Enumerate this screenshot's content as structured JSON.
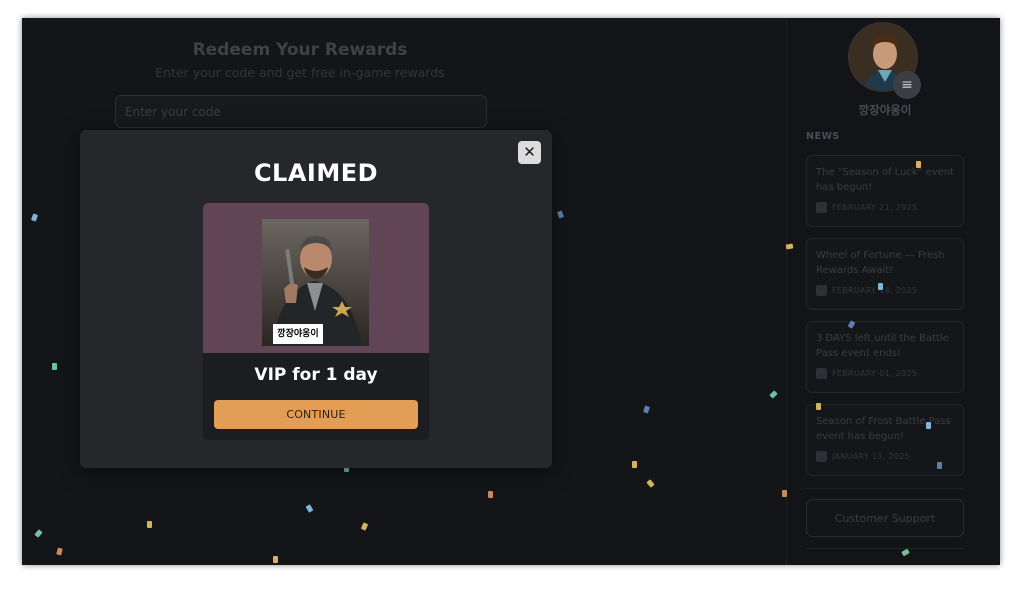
{
  "redeem": {
    "title": "Redeem Your Rewards",
    "subtitle": "Enter your code and get free in-game rewards",
    "input_placeholder": "Enter your code"
  },
  "sidebar": {
    "username": "깡장야옹이",
    "menu_icon": "hamburger-icon",
    "news_heading": "NEWS",
    "news": [
      {
        "title": "The \"Season of Luck\" event has begun!",
        "date": "FEBRUARY 21, 2025"
      },
      {
        "title": "Wheel of Fortune — Fresh Rewards Await!",
        "date": "FEBRUARY 14, 2025"
      },
      {
        "title": "3 DAYS left until the Battle Pass event ends!",
        "date": "FEBRUARY 01, 2025"
      },
      {
        "title": "Season of Frost Battle Pass event has begun!",
        "date": "JANUARY 13, 2025"
      }
    ],
    "support_label": "Customer Support"
  },
  "modal": {
    "heading": "CLAIMED",
    "close_icon": "close-icon",
    "reward_name": "VIP for 1 day",
    "reward_image_caption": "깡장야옹이",
    "continue_label": "CONTINUE"
  },
  "colors": {
    "background": "#141518",
    "modal_bg": "#26272b",
    "reward_bg": "#614554",
    "accent_button": "#e39d55"
  }
}
